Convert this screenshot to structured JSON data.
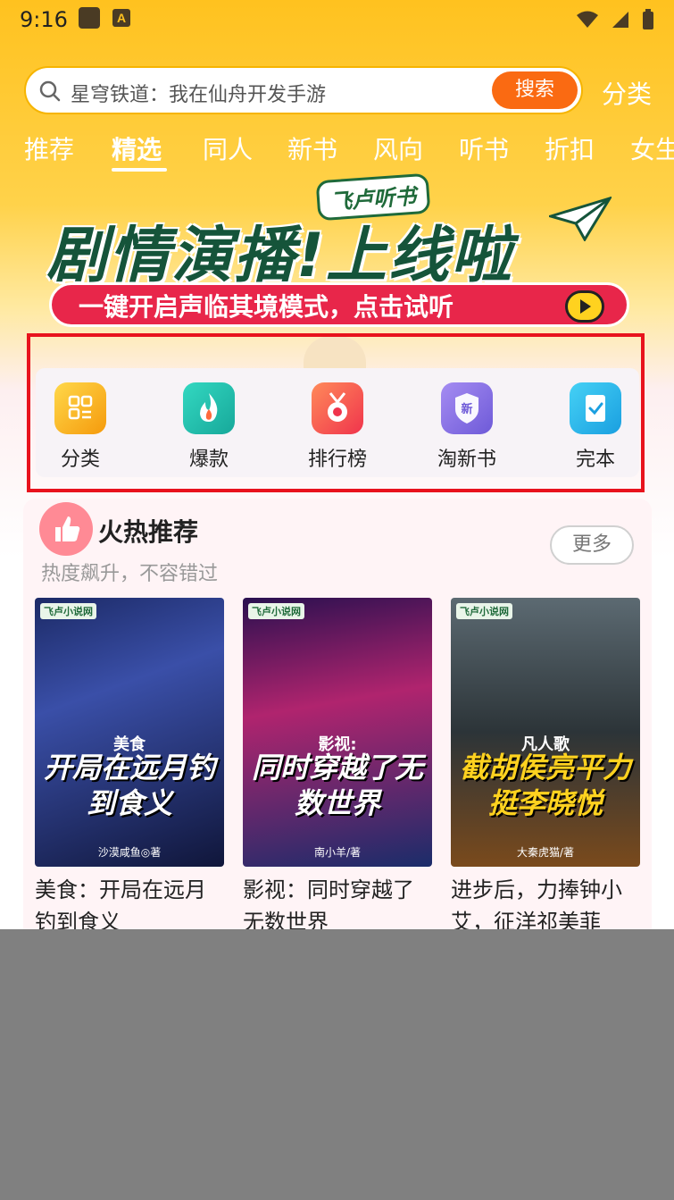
{
  "status": {
    "time": "9:16"
  },
  "search": {
    "placeholder": "星穹铁道：我在仙舟开发手游",
    "button_label": "搜索"
  },
  "header": {
    "category_link": "分类"
  },
  "tabs": [
    {
      "label": "推荐"
    },
    {
      "label": "精选"
    },
    {
      "label": "同人"
    },
    {
      "label": "新书"
    },
    {
      "label": "风向"
    },
    {
      "label": "听书"
    },
    {
      "label": "折扣"
    },
    {
      "label": "女生"
    }
  ],
  "active_tab": "精选",
  "banner": {
    "brand": "飞卢听书",
    "title": "剧情演播!上线啦",
    "subtitle": "一键开启声临其境模式，点击试听"
  },
  "quick_entries": [
    {
      "label": "分类",
      "icon": "category-grid-icon",
      "color": "#f9b314"
    },
    {
      "label": "爆款",
      "icon": "flame-icon",
      "color": "#21c6b2"
    },
    {
      "label": "排行榜",
      "icon": "medal-icon",
      "color": "#f2534b"
    },
    {
      "label": "淘新书",
      "icon": "new-shield-icon",
      "color": "#8b73e6"
    },
    {
      "label": "完本",
      "icon": "checklist-icon",
      "color": "#25b6ea"
    }
  ],
  "hot_section": {
    "title": "火热推荐",
    "subtitle": "热度飙升，不容错过",
    "more_label": "更多",
    "books": [
      {
        "title": "美食：开局在远月钓到食义",
        "cover_tag": "美食",
        "cover_title": "开局在远月钓到食义",
        "cover_author": "沙漠咸鱼◎著",
        "cover_logo": "飞卢小说网"
      },
      {
        "title": "影视：同时穿越了无数世界",
        "cover_tag": "影视:",
        "cover_title": "同时穿越了无数世界",
        "cover_author": "南小羊/著",
        "cover_logo": "飞卢小说网"
      },
      {
        "title": "进步后，力捧钟小艾，征洋祁美菲",
        "cover_tag": "凡人歌",
        "cover_title": "截胡侯亮平力挺李晓悦",
        "cover_author": "大秦虎猫/著",
        "cover_logo": "飞卢小说网"
      }
    ]
  },
  "highlight_color": "#e8131d"
}
